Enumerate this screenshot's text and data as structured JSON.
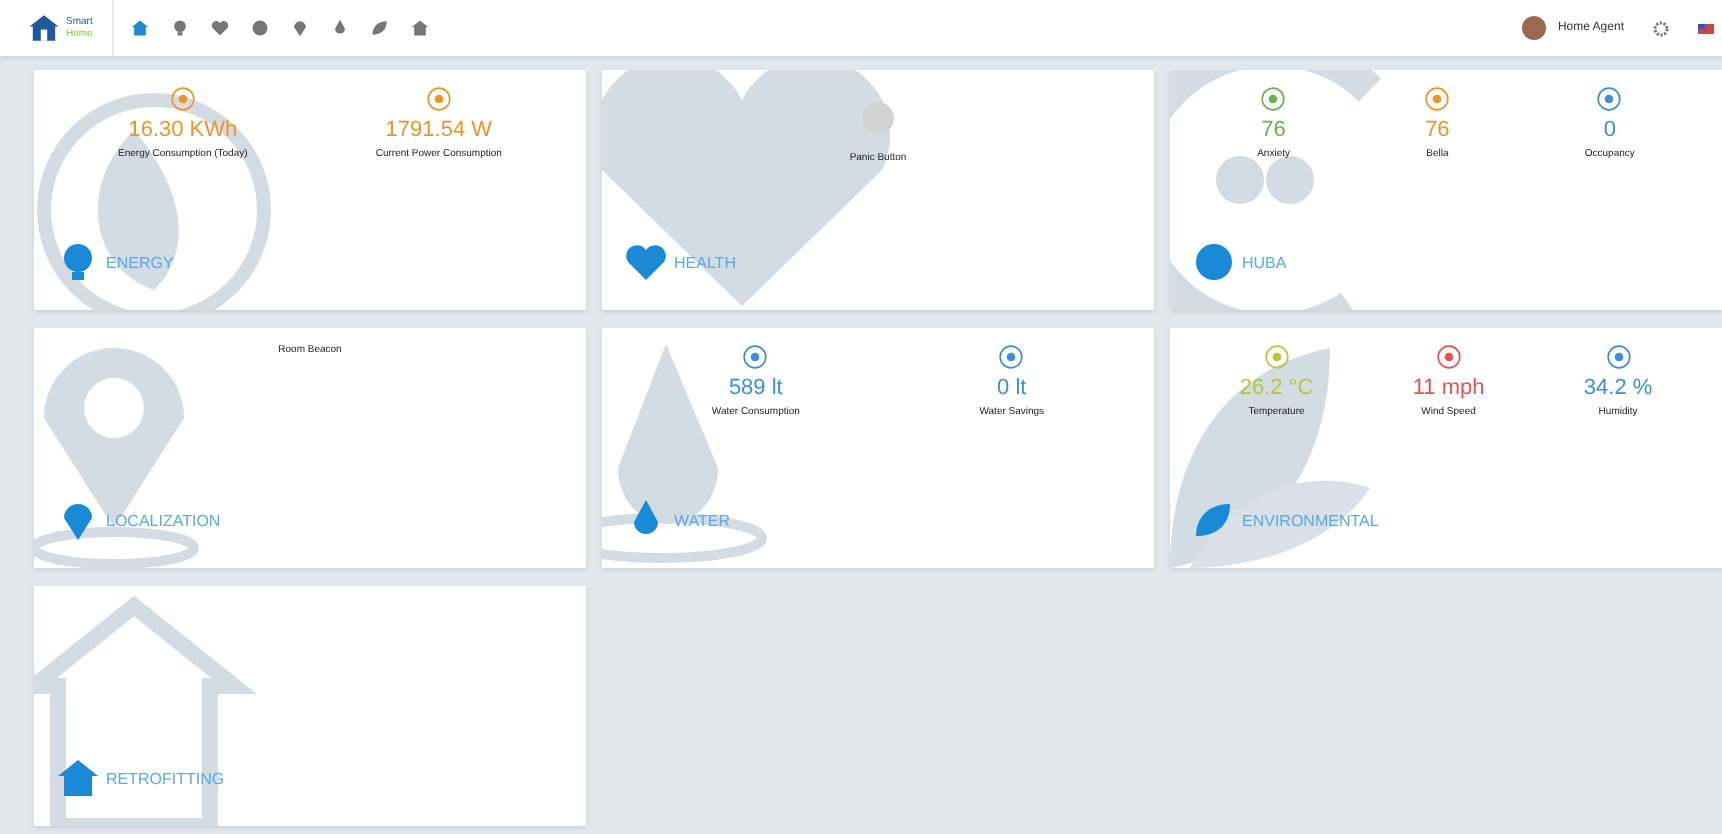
{
  "header": {
    "logo": {
      "line_1": "Smart",
      "line_2": "Home"
    },
    "nav": [
      {
        "kind": "home",
        "selected": true
      },
      {
        "kind": "energy",
        "selected": false
      },
      {
        "kind": "health",
        "selected": false
      },
      {
        "kind": "huba",
        "selected": false
      },
      {
        "kind": "localization",
        "selected": false
      },
      {
        "kind": "water",
        "selected": false
      },
      {
        "kind": "environmental",
        "selected": false
      },
      {
        "kind": "retrofitting",
        "selected": false
      }
    ],
    "user": "Home Agent"
  },
  "cards": [
    {
      "kind": "energy",
      "title": "ENERGY",
      "metrics": [
        {
          "kind": "stat",
          "value": "16.30 KWh",
          "label": "Energy Consumption (Today)",
          "color": "#f0932b"
        },
        {
          "kind": "stat",
          "value": "1791.54 W",
          "label": "Current Power Consumption",
          "color": "#f0932b"
        }
      ]
    },
    {
      "kind": "health",
      "title": "HEALTH",
      "metrics": [
        {
          "kind": "button",
          "label": "Panic Button"
        }
      ]
    },
    {
      "kind": "huba",
      "title": "HUBA",
      "metrics": [
        {
          "kind": "stat",
          "value": "76",
          "label": "Anxiety",
          "color": "#6ab04c"
        },
        {
          "kind": "stat",
          "value": "76",
          "label": "Bella",
          "color": "#f0932b"
        },
        {
          "kind": "stat",
          "value": "0",
          "label": "Occupancy",
          "color": "#3d8fd6"
        }
      ]
    },
    {
      "kind": "localization",
      "title": "LOCALIZATION",
      "metrics": [
        {
          "kind": "text",
          "label": "Room Beacon"
        }
      ]
    },
    {
      "kind": "water",
      "title": "WATER",
      "metrics": [
        {
          "kind": "stat",
          "value": "589 lt",
          "label": "Water Consumption",
          "color": "#3d8fd6"
        },
        {
          "kind": "stat",
          "value": "0 lt",
          "label": "Water Savings",
          "color": "#3d8fd6"
        }
      ]
    },
    {
      "kind": "environmental",
      "title": "ENVIRONMENTAL",
      "metrics": [
        {
          "kind": "stat",
          "value": "26.2 °C",
          "label": "Temperature",
          "color": "#b5c63a"
        },
        {
          "kind": "stat",
          "value": "11 mph",
          "label": "Wind Speed",
          "color": "#e55353"
        },
        {
          "kind": "stat",
          "value": "34.2 %",
          "label": "Humidity",
          "color": "#3d8fd6"
        }
      ]
    },
    {
      "kind": "retrofitting",
      "title": "RETROFITTING"
    }
  ]
}
